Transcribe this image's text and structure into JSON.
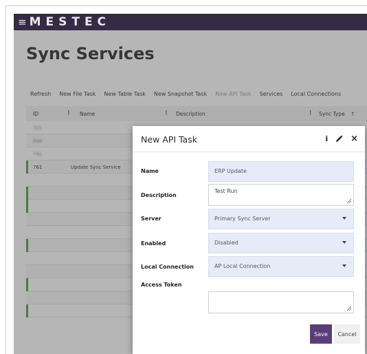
{
  "app": {
    "brand": "MESTEC",
    "menu_glyph": "≡"
  },
  "page": {
    "title": "Sync Services"
  },
  "toolbar": {
    "buttons": [
      {
        "label": "Refresh",
        "enabled": true
      },
      {
        "label": "New File Task",
        "enabled": true
      },
      {
        "label": "New Table Task",
        "enabled": true
      },
      {
        "label": "New Snapshot Task",
        "enabled": true
      },
      {
        "label": "New API Task",
        "enabled": false
      },
      {
        "label": "Services",
        "enabled": true
      },
      {
        "label": "Local Connections",
        "enabled": true
      }
    ]
  },
  "table": {
    "columns": [
      "ID",
      "Name",
      "Description",
      "Sync Type"
    ],
    "sort_glyph": "↑",
    "rows": [
      {
        "id": "721",
        "name": "",
        "status_bar": false,
        "highlight": false
      },
      {
        "id": "644",
        "name": "",
        "status_bar": false,
        "highlight": false
      },
      {
        "id": "741",
        "name": "",
        "status_bar": false,
        "highlight": false
      },
      {
        "id": "761",
        "name": "Update Sync Service",
        "status_bar": true,
        "highlight": true
      },
      {
        "id": "",
        "name": "",
        "status_bar": false,
        "highlight": false
      },
      {
        "id": "",
        "name": "",
        "status_bar": true,
        "highlight": false
      },
      {
        "id": "",
        "name": "",
        "status_bar": true,
        "highlight": false
      },
      {
        "id": "",
        "name": "",
        "status_bar": false,
        "highlight": false
      },
      {
        "id": "",
        "name": "",
        "status_bar": false,
        "highlight": false
      },
      {
        "id": "",
        "name": "",
        "status_bar": true,
        "highlight": false
      },
      {
        "id": "",
        "name": "",
        "status_bar": false,
        "highlight": false
      },
      {
        "id": "",
        "name": "",
        "status_bar": false,
        "highlight": false
      },
      {
        "id": "",
        "name": "",
        "status_bar": true,
        "highlight": false
      },
      {
        "id": "",
        "name": "",
        "status_bar": false,
        "highlight": false
      },
      {
        "id": "",
        "name": "",
        "status_bar": true,
        "highlight": false
      }
    ]
  },
  "modal": {
    "title": "New API Task",
    "info_glyph": "i",
    "close_glyph": "×",
    "fields": {
      "name": {
        "label": "Name",
        "value": "ERP Update"
      },
      "description": {
        "label": "Description",
        "value": "Test Run"
      },
      "server": {
        "label": "Server",
        "value": "Primary Sync Server"
      },
      "enabled": {
        "label": "Enabled",
        "value": "Disabled"
      },
      "local_connection": {
        "label": "Local Connection",
        "value": "AP Local Connection"
      },
      "access_token": {
        "label": "Access Token",
        "value": ""
      }
    },
    "save_label": "Save",
    "cancel_label": "Cancel"
  },
  "colors": {
    "brand_bar": "#362a45",
    "primary_button": "#5a3e7a",
    "field_fill": "#e6ecf7",
    "status_green": "#4c9a3f"
  }
}
